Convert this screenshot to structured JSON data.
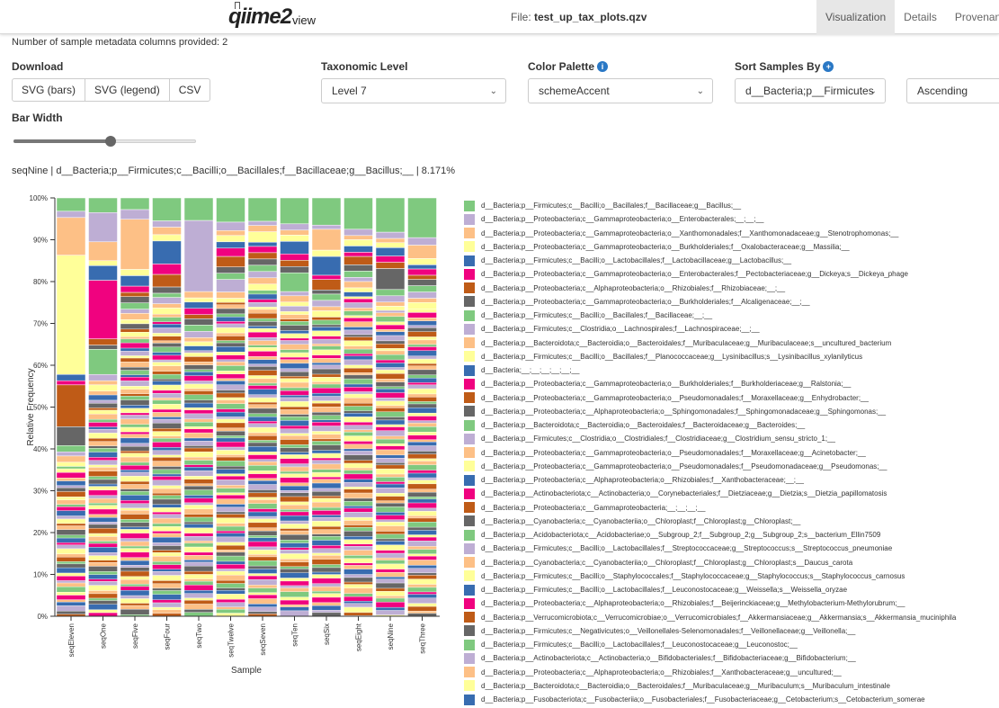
{
  "header": {
    "logo_q": "qiime",
    "logo_2": "2",
    "logo_view": "view",
    "file_prefix": "File:",
    "file_name": "test_up_tax_plots.qzv",
    "tabs": [
      {
        "label": "Visualization",
        "active": true
      },
      {
        "label": "Details",
        "active": false
      },
      {
        "label": "Provenance",
        "active": false
      }
    ]
  },
  "metadata_note": "Number of sample metadata columns provided: 2",
  "controls": {
    "download_label": "Download",
    "download_buttons": [
      "SVG (bars)",
      "SVG (legend)",
      "CSV"
    ],
    "taxonomic_level_label": "Taxonomic Level",
    "taxonomic_level_value": "Level 7",
    "color_palette_label": "Color Palette",
    "color_palette_value": "schemeAccent",
    "sort_label": "Sort Samples By",
    "sort_value": "d__Bacteria;p__Firmicutes",
    "sort_order_value": "Ascending",
    "bar_width_label": "Bar Width",
    "bar_width_value": 0.53
  },
  "selection_info": "seqNine | d__Bacteria;p__Firmicutes;c__Bacilli;o__Bacillales;f__Bacillaceae;g__Bacillus;__ | 8.171%",
  "palette": [
    "#7fc97f",
    "#beaed4",
    "#fdc086",
    "#ffff99",
    "#386cb0",
    "#f0027f",
    "#bf5b17",
    "#666666"
  ],
  "chart_data": {
    "type": "bar",
    "stacked": true,
    "xlabel": "Sample",
    "ylabel": "Relative Frequency",
    "ylim": [
      0,
      100
    ],
    "yticks": [
      "0%",
      "10%",
      "20%",
      "30%",
      "40%",
      "50%",
      "60%",
      "70%",
      "80%",
      "90%",
      "100%"
    ],
    "categories": [
      "seqEleven",
      "seqOne",
      "seqFive",
      "seqFour",
      "seqTwo",
      "seqTwelve",
      "seqSeven",
      "seqTen",
      "seqSix",
      "seqEight",
      "seqNine",
      "seqThree"
    ],
    "series": [
      {
        "taxon": "d__Bacteria;p__Firmicutes;c__Bacilli;o__Bacillales;f__Bacillaceae;g__Bacillus;__",
        "values": [
          3.2,
          3.5,
          2.8,
          5.5,
          5.4,
          5.8,
          5.6,
          6.2,
          6.5,
          7.5,
          8.2,
          9.5
        ]
      },
      {
        "taxon": "d__Bacteria;p__Proteobacteria;c__Gammaproteobacteria;o__Enterobacterales;__;__;__",
        "values": [
          1.5,
          7.0,
          2.3,
          1.5,
          17.0,
          2.0,
          1.0,
          1.5,
          1.0,
          1.5,
          1.5,
          1.8
        ]
      },
      {
        "taxon": "d__Bacteria;p__Proteobacteria;c__Gammaproteobacteria;o__Xanthomonadales;f__Xanthomonadaceae;g__Stenotrophomonas;__",
        "values": [
          9.0,
          4.5,
          12.0,
          1.8,
          1.5,
          1.2,
          1.5,
          1.2,
          5.0,
          1.0,
          1.0,
          3.2
        ]
      },
      {
        "taxon": "d__Bacteria;p__Proteobacteria;c__Gammaproteobacteria;o__Burkholderiales;f__Oxalobacteraceae;g__Massilia;__",
        "values": [
          28.5,
          1.2,
          1.5,
          1.5,
          1.0,
          1.5,
          2.5,
          1.5,
          1.5,
          1.5,
          1.2,
          1.5
        ]
      },
      {
        "taxon": "d__Bacteria;p__Firmicutes;c__Bacilli;o__Lactobacillales;f__Lactobacillaceae;g__Lactobacillus;__",
        "values": [
          1.5,
          3.5,
          2.5,
          5.5,
          1.5,
          1.5,
          1.0,
          3.0,
          4.5,
          1.5,
          2.0,
          1.0
        ]
      },
      {
        "taxon": "d__Bacteria;p__Proteobacteria;c__Gammaproteobacteria;o__Enterobacterales;f__Pectobacteriaceae;g__Dickeya;s__Dickeya_phage",
        "values": [
          1.0,
          14.0,
          1.5,
          2.5,
          1.5,
          2.0,
          1.5,
          1.5,
          1.0,
          1.0,
          1.5,
          1.5
        ]
      },
      {
        "taxon": "d__Bacteria;p__Proteobacteria;c__Alphaproteobacteria;o__Rhizobiales;f__Rhizobiaceae;__;__",
        "values": [
          10.0,
          1.5,
          1.0,
          3.0,
          1.0,
          2.5,
          1.5,
          1.5,
          2.5,
          2.0,
          1.5,
          1.0
        ]
      },
      {
        "taxon": "d__Bacteria;p__Proteobacteria;c__Gammaproteobacteria;o__Burkholderiales;f__Alcaligenaceae;__;__",
        "values": [
          4.5,
          1.0,
          1.5,
          1.5,
          1.5,
          1.5,
          1.5,
          1.5,
          1.0,
          1.5,
          5.0,
          1.5
        ]
      },
      {
        "taxon": "d__Bacteria;p__Firmicutes;c__Bacilli;o__Bacillales;f__Bacillaceae;__;__",
        "values": [
          1.5,
          6.0,
          1.5,
          1.0,
          1.5,
          1.5,
          1.5,
          4.5,
          1.5,
          1.5,
          1.5,
          1.5
        ]
      },
      {
        "taxon": "d__Bacteria;p__Firmicutes;c__Clostridia;o__Lachnospirales;f__Lachnospiraceae;__;__",
        "values": [
          1.0,
          1.5,
          1.0,
          1.5,
          1.5,
          3.0,
          1.5,
          1.0,
          1.5,
          1.0,
          1.5,
          1.5
        ]
      },
      {
        "taxon": "d__Bacteria;p__Bacteroidota;c__Bacteroidia;o__Bacteroidales;f__Muribaculaceae;g__Muribaculaceae;s__uncultured_bacterium",
        "values": [
          1.5,
          1.0,
          1.5,
          1.0,
          1.0,
          1.5,
          1.5,
          1.5,
          1.0,
          1.5,
          1.0,
          1.0
        ]
      },
      {
        "taxon": "d__Bacteria;p__Firmicutes;c__Bacilli;o__Bacillales;f__Planococcaceae;g__Lysinibacillus;s__Lysinibacillus_xylanilyticus",
        "values": [
          1.0,
          1.5,
          1.0,
          1.5,
          1.0,
          1.0,
          1.5,
          1.0,
          1.5,
          1.0,
          1.0,
          1.5
        ]
      }
    ],
    "legend": [
      "d__Bacteria;p__Firmicutes;c__Bacilli;o__Bacillales;f__Bacillaceae;g__Bacillus;__",
      "d__Bacteria;p__Proteobacteria;c__Gammaproteobacteria;o__Enterobacterales;__;__;__",
      "d__Bacteria;p__Proteobacteria;c__Gammaproteobacteria;o__Xanthomonadales;f__Xanthomonadaceae;g__Stenotrophomonas;__",
      "d__Bacteria;p__Proteobacteria;c__Gammaproteobacteria;o__Burkholderiales;f__Oxalobacteraceae;g__Massilia;__",
      "d__Bacteria;p__Firmicutes;c__Bacilli;o__Lactobacillales;f__Lactobacillaceae;g__Lactobacillus;__",
      "d__Bacteria;p__Proteobacteria;c__Gammaproteobacteria;o__Enterobacterales;f__Pectobacteriaceae;g__Dickeya;s__Dickeya_phage",
      "d__Bacteria;p__Proteobacteria;c__Alphaproteobacteria;o__Rhizobiales;f__Rhizobiaceae;__;__",
      "d__Bacteria;p__Proteobacteria;c__Gammaproteobacteria;o__Burkholderiales;f__Alcaligenaceae;__;__",
      "d__Bacteria;p__Firmicutes;c__Bacilli;o__Bacillales;f__Bacillaceae;__;__",
      "d__Bacteria;p__Firmicutes;c__Clostridia;o__Lachnospirales;f__Lachnospiraceae;__;__",
      "d__Bacteria;p__Bacteroidota;c__Bacteroidia;o__Bacteroidales;f__Muribaculaceae;g__Muribaculaceae;s__uncultured_bacterium",
      "d__Bacteria;p__Firmicutes;c__Bacilli;o__Bacillales;f__Planococcaceae;g__Lysinibacillus;s__Lysinibacillus_xylanilyticus",
      "d__Bacteria;__;__;__;__;__;__",
      "d__Bacteria;p__Proteobacteria;c__Gammaproteobacteria;o__Burkholderiales;f__Burkholderiaceae;g__Ralstonia;__",
      "d__Bacteria;p__Proteobacteria;c__Gammaproteobacteria;o__Pseudomonadales;f__Moraxellaceae;g__Enhydrobacter;__",
      "d__Bacteria;p__Proteobacteria;c__Alphaproteobacteria;o__Sphingomonadales;f__Sphingomonadaceae;g__Sphingomonas;__",
      "d__Bacteria;p__Bacteroidota;c__Bacteroidia;o__Bacteroidales;f__Bacteroidaceae;g__Bacteroides;__",
      "d__Bacteria;p__Firmicutes;c__Clostridia;o__Clostridiales;f__Clostridiaceae;g__Clostridium_sensu_stricto_1;__",
      "d__Bacteria;p__Proteobacteria;c__Gammaproteobacteria;o__Pseudomonadales;f__Moraxellaceae;g__Acinetobacter;__",
      "d__Bacteria;p__Proteobacteria;c__Gammaproteobacteria;o__Pseudomonadales;f__Pseudomonadaceae;g__Pseudomonas;__",
      "d__Bacteria;p__Proteobacteria;c__Alphaproteobacteria;o__Rhizobiales;f__Xanthobacteraceae;__;__",
      "d__Bacteria;p__Actinobacteriota;c__Actinobacteria;o__Corynebacteriales;f__Dietziaceae;g__Dietzia;s__Dietzia_papillomatosis",
      "d__Bacteria;p__Proteobacteria;c__Gammaproteobacteria;__;__;__;__",
      "d__Bacteria;p__Cyanobacteria;c__Cyanobacteriia;o__Chloroplast;f__Chloroplast;g__Chloroplast;__",
      "d__Bacteria;p__Acidobacteriota;c__Acidobacteriae;o__Subgroup_2;f__Subgroup_2;g__Subgroup_2;s__bacterium_Ellin7509",
      "d__Bacteria;p__Firmicutes;c__Bacilli;o__Lactobacillales;f__Streptococcaceae;g__Streptococcus;s__Streptococcus_pneumoniae",
      "d__Bacteria;p__Cyanobacteria;c__Cyanobacteriia;o__Chloroplast;f__Chloroplast;g__Chloroplast;s__Daucus_carota",
      "d__Bacteria;p__Firmicutes;c__Bacilli;o__Staphylococcales;f__Staphylococcaceae;g__Staphylococcus;s__Staphylococcus_carnosus",
      "d__Bacteria;p__Firmicutes;c__Bacilli;o__Lactobacillales;f__Leuconostocaceae;g__Weissella;s__Weissella_oryzae",
      "d__Bacteria;p__Proteobacteria;c__Alphaproteobacteria;o__Rhizobiales;f__Beijerinckiaceae;g__Methylobacterium-Methylorubrum;__",
      "d__Bacteria;p__Verrucomicrobiota;c__Verrucomicrobiae;o__Verrucomicrobiales;f__Akkermansiaceae;g__Akkermansia;s__Akkermansia_muciniphila",
      "d__Bacteria;p__Firmicutes;c__Negativicutes;o__Veillonellales-Selenomonadales;f__Veillonellaceae;g__Veillonella;__",
      "d__Bacteria;p__Firmicutes;c__Bacilli;o__Lactobacillales;f__Leuconostocaceae;g__Leuconostoc;__",
      "d__Bacteria;p__Actinobacteriota;c__Actinobacteria;o__Bifidobacteriales;f__Bifidobacteriaceae;g__Bifidobacterium;__",
      "d__Bacteria;p__Proteobacteria;c__Alphaproteobacteria;o__Rhizobiales;f__Xanthobacteraceae;g__uncultured;__",
      "d__Bacteria;p__Bacteroidota;c__Bacteroidia;o__Bacteroidales;f__Muribaculaceae;g__Muribaculum;s__Muribaculum_intestinale",
      "d__Bacteria;p__Fusobacteriota;c__Fusobacteriia;o__Fusobacteriales;f__Fusobacteriaceae;g__Cetobacterium;s__Cetobacterium_somerae"
    ]
  }
}
